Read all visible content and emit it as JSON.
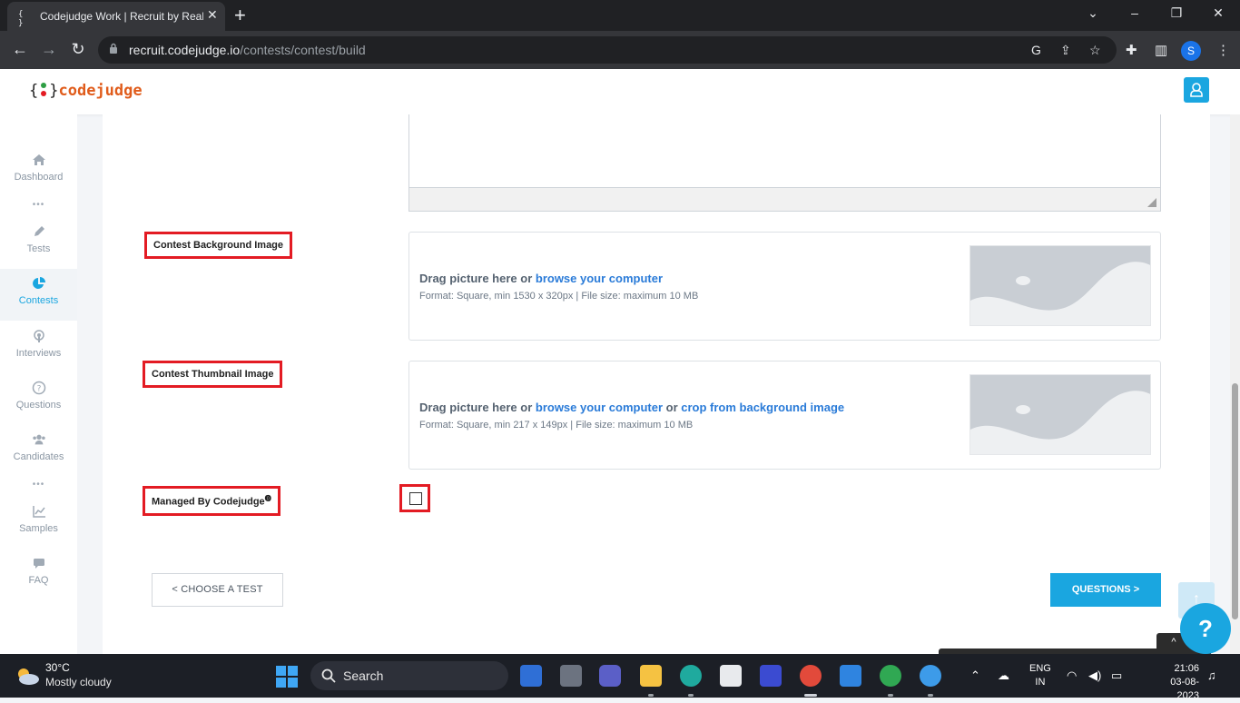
{
  "browser": {
    "tab_title": "Codejudge Work | Recruit by Real",
    "tab_favicon": "{ }",
    "url_host": "recruit.codejudge.io",
    "url_path": "/contests/contest/build",
    "profile_initial": "S"
  },
  "app": {
    "logo_open": "{",
    "logo_close": "}",
    "logo_word": "codejudge",
    "accent_color": "#1aa6e0",
    "logo_color": "#e05c1b"
  },
  "sidebar": {
    "items": [
      {
        "label": "Dashboard",
        "icon": "home-icon"
      },
      {
        "label": "Tests",
        "icon": "pencil-icon"
      },
      {
        "label": "Contests",
        "icon": "pie-chart-icon",
        "active": true
      },
      {
        "label": "Interviews",
        "icon": "podcast-icon"
      },
      {
        "label": "Questions",
        "icon": "question-circle-icon"
      },
      {
        "label": "Candidates",
        "icon": "users-icon"
      },
      {
        "label": "Samples",
        "icon": "line-chart-icon"
      },
      {
        "label": "FAQ",
        "icon": "comments-icon"
      }
    ],
    "separator": "•••"
  },
  "form": {
    "background_label": "Contest Background Image",
    "background_drag": "Drag picture here or ",
    "background_browse": "browse your computer",
    "background_format": "Format: Square, min 1530 x 320px | File size: maximum 10 MB",
    "thumbnail_label": "Contest Thumbnail Image",
    "thumbnail_drag": "Drag picture here or ",
    "thumbnail_browse": "browse your computer",
    "thumbnail_or": " or ",
    "thumbnail_crop": "crop from background image",
    "thumbnail_format": "Format: Square, min 217 x 149px | File size: maximum 10 MB",
    "managed_label": "Managed By Codejudge",
    "managed_info": "⓿",
    "managed_checked": false
  },
  "nav": {
    "back_label": "< CHOOSE A TEST",
    "next_label": "QUESTIONS >",
    "help_label": "?",
    "scroll_top": "↑",
    "dock_chevron": "^"
  },
  "taskbar": {
    "temperature": "30°C",
    "condition": "Mostly cloudy",
    "search_label": "Search",
    "lang_line1": "ENG",
    "lang_line2": "IN",
    "time": "21:06",
    "date": "03-08-2023"
  }
}
